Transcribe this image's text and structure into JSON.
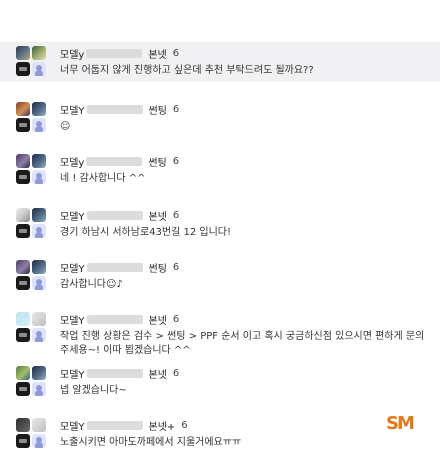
{
  "comments": [
    {
      "nick": "모델y",
      "grade": "본넷",
      "level": "6",
      "text": "너무 어둡지 않게 진행하고 싶은데 추천 부탁드려도 될까요??",
      "highlight": true
    },
    {
      "nick": "모델Y",
      "grade": "썬팅",
      "level": "6",
      "text": "☺"
    },
    {
      "nick": "모델y",
      "grade": "썬팅",
      "level": "6",
      "text": "네 ! 감사합니다 ^^"
    },
    {
      "nick": "모델Y",
      "grade": "본넷",
      "level": "6",
      "text": "경기 하남시 서하남로43번길 12 입니다!"
    },
    {
      "nick": "모델Y",
      "grade": "썬팅",
      "level": "6",
      "text": "감사합니다☺♪"
    },
    {
      "nick": "모델Y",
      "grade": "본넷",
      "level": "6",
      "text": "작업 진행 상황은 검수 > 썬팅 > PPF 순서 이고 혹시 궁금하신점 있으시면 편하게 문의주세용~! 이따 뵙겠습니다 ^^"
    },
    {
      "nick": "모델Y",
      "grade": "본넷",
      "level": "6",
      "text": "넵 알겠습니다~"
    },
    {
      "nick": "모델Y",
      "grade": "본넷+",
      "level": "6",
      "text": "노출시키면 아마도까페에서 지울거에요ㅠㅠ"
    }
  ],
  "logo": {
    "text": "SM",
    "color": "#e07a1a"
  }
}
